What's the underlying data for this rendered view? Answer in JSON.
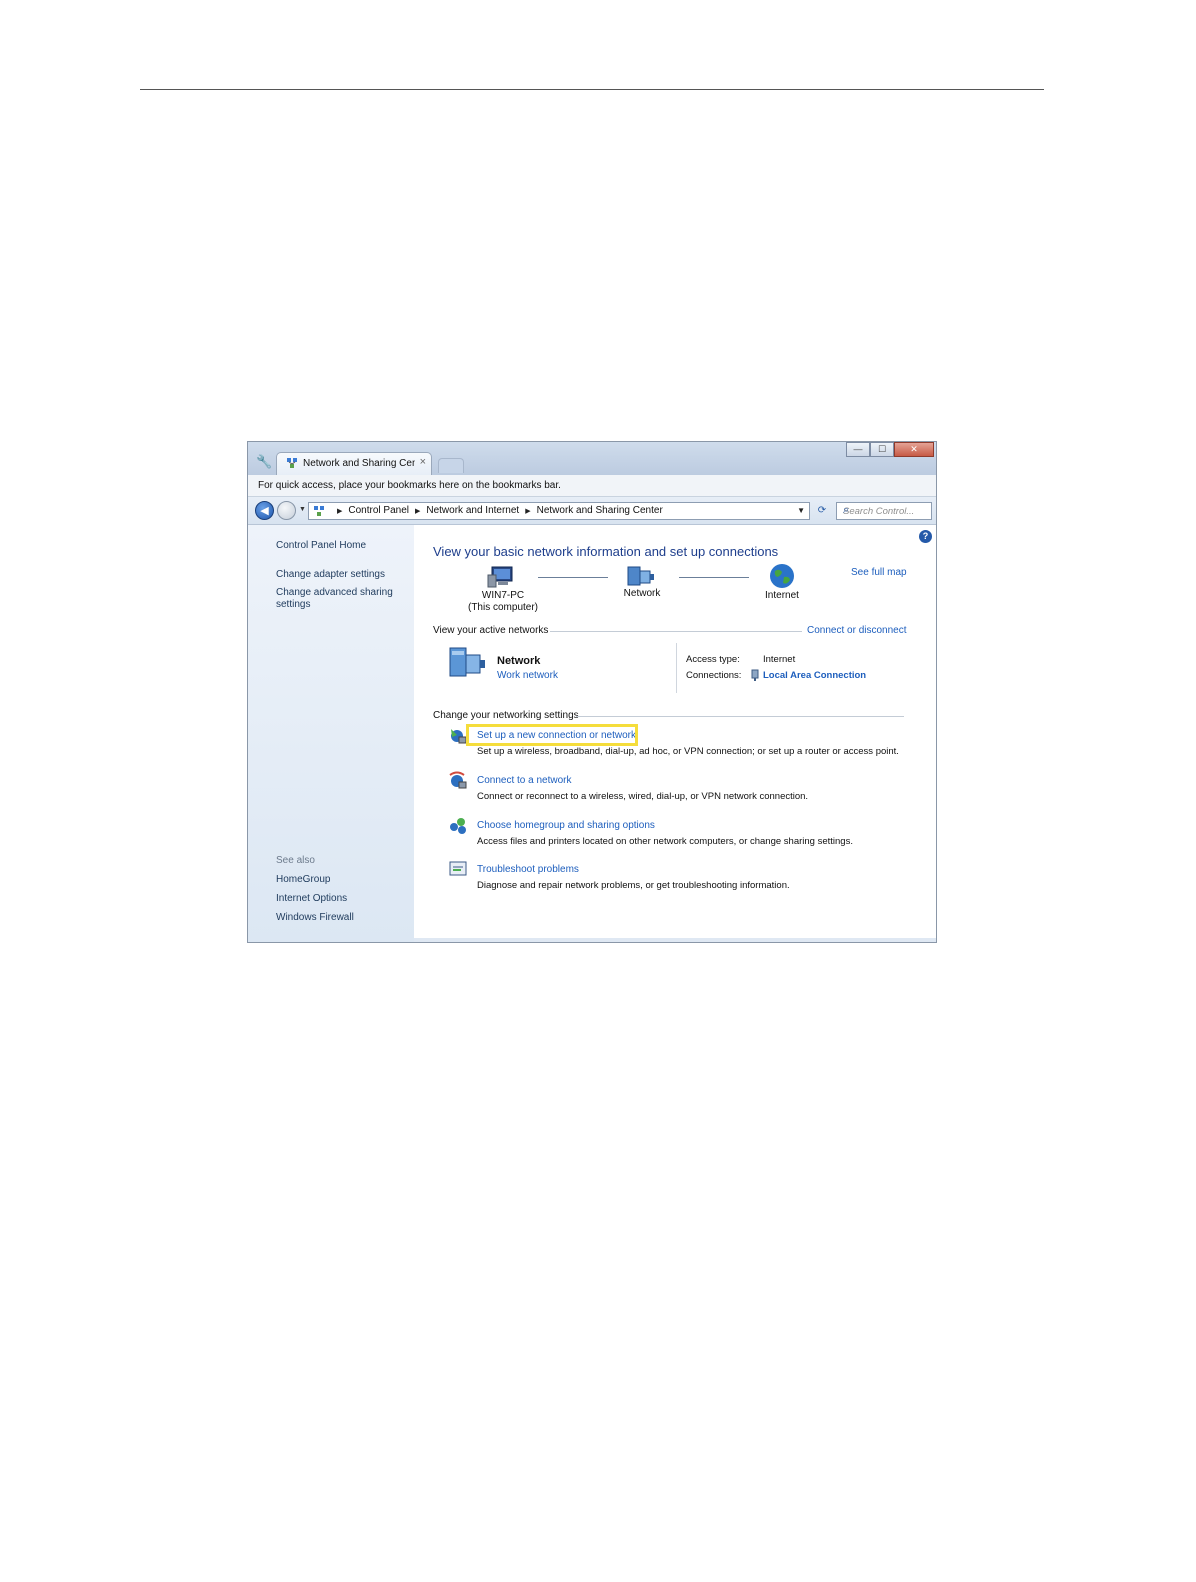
{
  "browser": {
    "tab_title": "Network and Sharing Cent",
    "tab_close": "×",
    "bookmarks_hint": "For quick access, place your bookmarks here on the bookmarks bar."
  },
  "window_buttons": {
    "minimize": "—",
    "maximize": "☐",
    "close": "✕"
  },
  "address_bar": {
    "breadcrumbs": [
      "Control Panel",
      "Network and Internet",
      "Network and Sharing Center"
    ],
    "search_placeholder": "Search Control..."
  },
  "left_pane": {
    "home": "Control Panel Home",
    "links": [
      "Change adapter settings",
      "Change advanced sharing",
      "settings"
    ],
    "see_also_header": "See also",
    "see_also": [
      "HomeGroup",
      "Internet Options",
      "Windows Firewall"
    ]
  },
  "main": {
    "title": "View your basic network information and set up connections",
    "see_full_map": "See full map",
    "map": {
      "computer": "WIN7-PC",
      "computer_sub": "(This computer)",
      "network": "Network",
      "internet": "Internet"
    },
    "active_networks_header": "View your active networks",
    "connect_or_disconnect": "Connect or disconnect",
    "active_network": {
      "name": "Network",
      "type": "Work network",
      "access_type_label": "Access type:",
      "access_type_value": "Internet",
      "connections_label": "Connections:",
      "connections_value": "Local Area Connection"
    },
    "settings_header": "Change your networking settings",
    "tasks": [
      {
        "link": "Set up a new connection or network",
        "desc": "Set up a wireless, broadband, dial-up, ad hoc, or VPN connection; or set up a router or access point."
      },
      {
        "link": "Connect to a network",
        "desc": "Connect or reconnect to a wireless, wired, dial-up, or VPN network connection."
      },
      {
        "link": "Choose homegroup and sharing options",
        "desc": "Access files and printers located on other network computers, or change sharing settings."
      },
      {
        "link": "Troubleshoot problems",
        "desc": "Diagnose and repair network problems, or get troubleshooting information."
      }
    ]
  },
  "colors": {
    "link": "#1d5ebd",
    "title": "#1e3e8c",
    "highlight": "#f5dd3b"
  }
}
